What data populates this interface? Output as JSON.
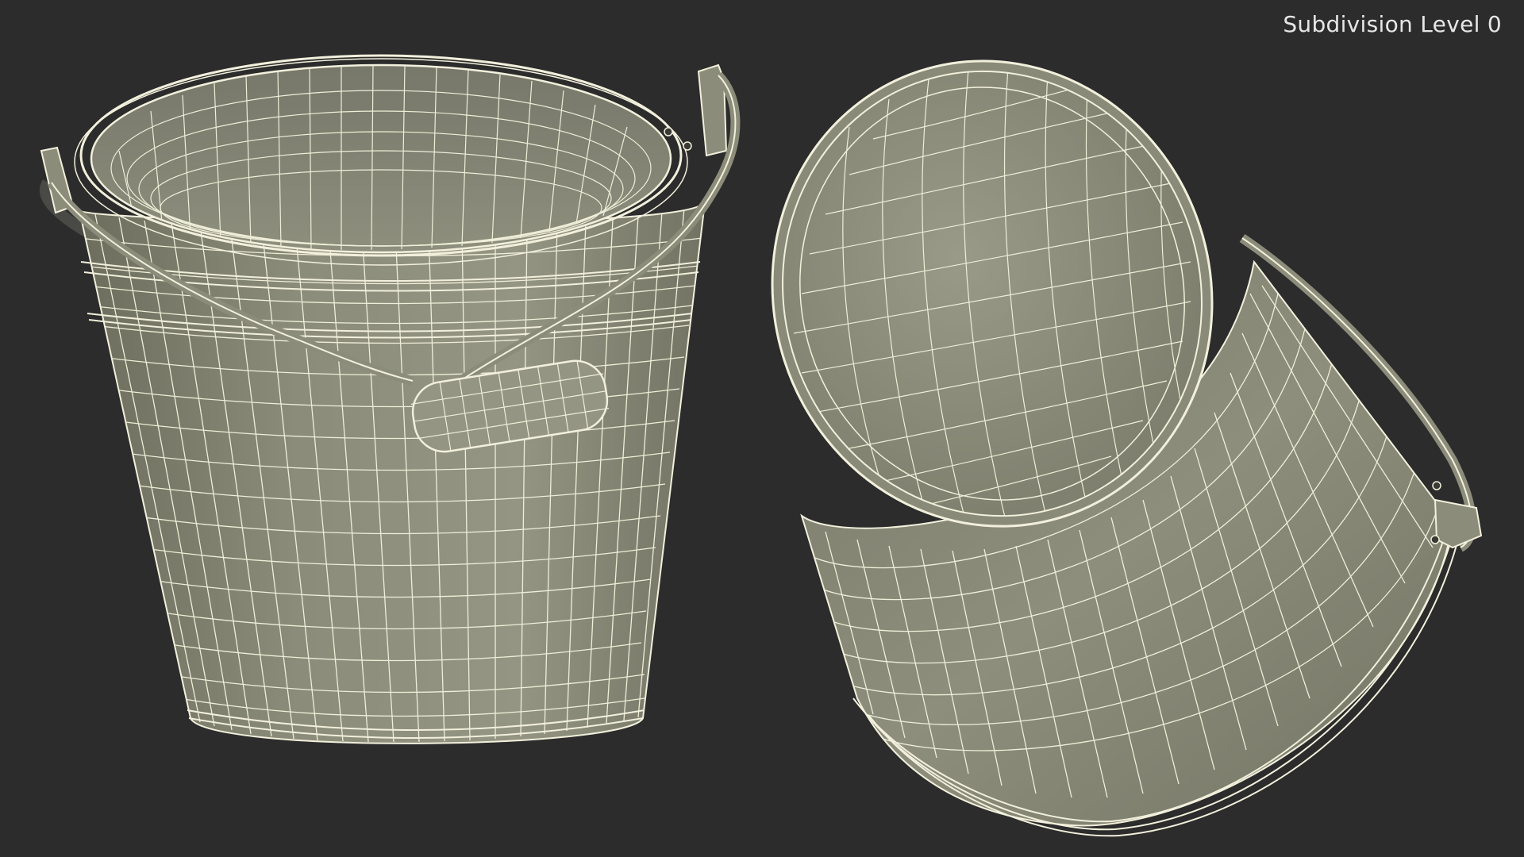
{
  "overlay": {
    "subdivision_label": "Subdivision Level 0"
  },
  "colors": {
    "background": "#2c2c2c",
    "mesh_fill": "#8a8a78",
    "mesh_fill_dark": "#6e6e5f",
    "mesh_fill_light": "#a3a391",
    "wire": "#f2f0dc",
    "label": "#e6e6e6"
  },
  "objects": [
    {
      "name": "bucket-upright",
      "view": "three-quarter upright view with swing handle and grip"
    },
    {
      "name": "bucket-tilted",
      "view": "tilted view showing bottom"
    }
  ]
}
